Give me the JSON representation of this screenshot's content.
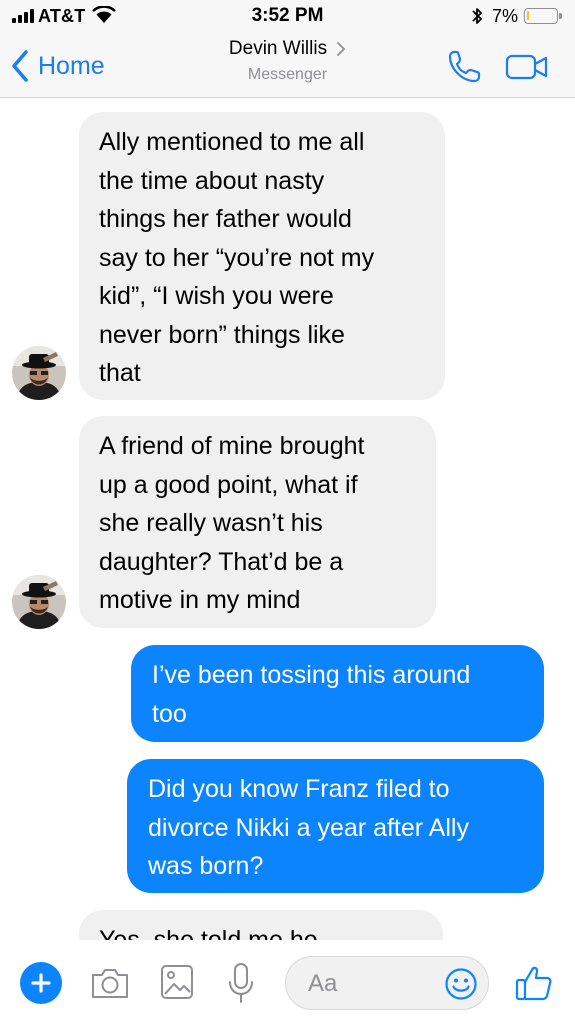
{
  "status_bar": {
    "carrier": "AT&T",
    "time": "3:52 PM",
    "battery_percent": "7%",
    "battery_level": 0.07,
    "icons": [
      "signal-bars-icon",
      "wifi-icon",
      "bluetooth-icon",
      "battery-icon"
    ],
    "battery_color": "#f0c419"
  },
  "nav": {
    "back_label": "Home",
    "contact_name": "Devin Willis",
    "contact_subtitle": "Messenger",
    "icons": [
      "back-chevron-icon",
      "chevron-right-icon",
      "phone-icon",
      "video-camera-icon"
    ]
  },
  "messages": [
    {
      "sender": "contact",
      "text": "Ally mentioned to me all\nthe time about nasty\nthings her father would\nsay to her “you’re not my\nkid”, “I wish you were\nnever born” things like\nthat"
    },
    {
      "sender": "contact",
      "text": "A friend of mine brought\nup a good point, what if\nshe really wasn’t his\ndaughter?  That’d be a\nmotive in my mind"
    },
    {
      "sender": "me",
      "text": "I’ve been tossing this around\ntoo"
    },
    {
      "sender": "me",
      "text": "Did you know Franz filed to\ndivorce Nikki a year after Ally\nwas born?"
    },
    {
      "sender": "contact",
      "text": "Yes, she told me he"
    }
  ],
  "composer": {
    "placeholder": "Aa",
    "icons": [
      "plus-icon",
      "camera-icon",
      "gallery-icon",
      "microphone-icon",
      "emoji-icon",
      "thumbs-up-icon"
    ]
  },
  "colors": {
    "accent": "#0c84fe",
    "link": "#1a7ef1",
    "incoming_bubble": "#f1f0f0",
    "bar_background": "#f7f7f7"
  }
}
